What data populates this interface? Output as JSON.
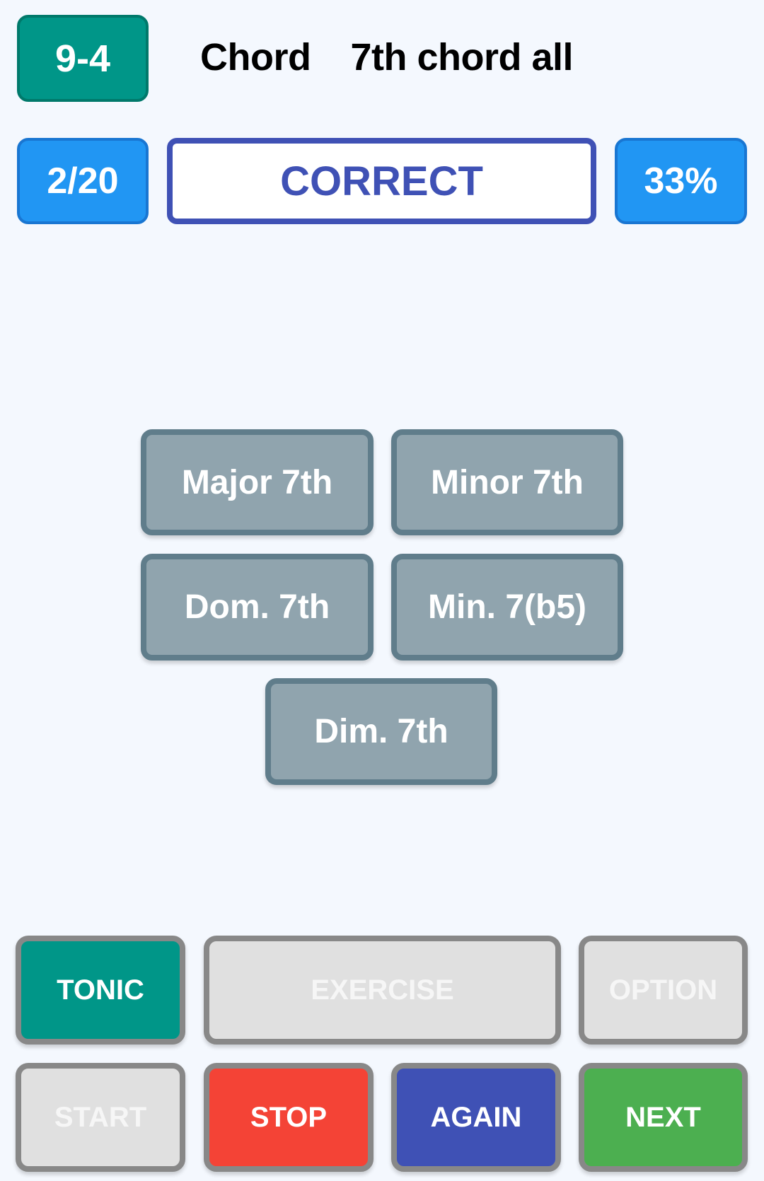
{
  "header": {
    "lesson_id": "9-4",
    "category": "Chord",
    "exercise_name": "7th chord all"
  },
  "status": {
    "progress": "2/20",
    "result": "CORRECT",
    "score": "33%"
  },
  "answers": [
    {
      "label": "Major 7th"
    },
    {
      "label": "Minor 7th"
    },
    {
      "label": "Dom. 7th"
    },
    {
      "label": "Min. 7(b5)"
    },
    {
      "label": "Dim. 7th"
    }
  ],
  "controls": {
    "tonic": {
      "label": "TONIC",
      "enabled": true
    },
    "exercise": {
      "label": "EXERCISE",
      "enabled": false
    },
    "option": {
      "label": "OPTION",
      "enabled": false
    },
    "start": {
      "label": "START",
      "enabled": false
    },
    "stop": {
      "label": "STOP",
      "enabled": true
    },
    "again": {
      "label": "AGAIN",
      "enabled": true
    },
    "next": {
      "label": "NEXT",
      "enabled": true
    }
  },
  "colors": {
    "teal": "#009688",
    "blue": "#2196F3",
    "indigo": "#3F51B5",
    "answer_fill": "#90A4AE",
    "answer_border": "#607D8B",
    "red": "#F44336",
    "green": "#4CAF50",
    "disabled": "#E0E0E0"
  }
}
